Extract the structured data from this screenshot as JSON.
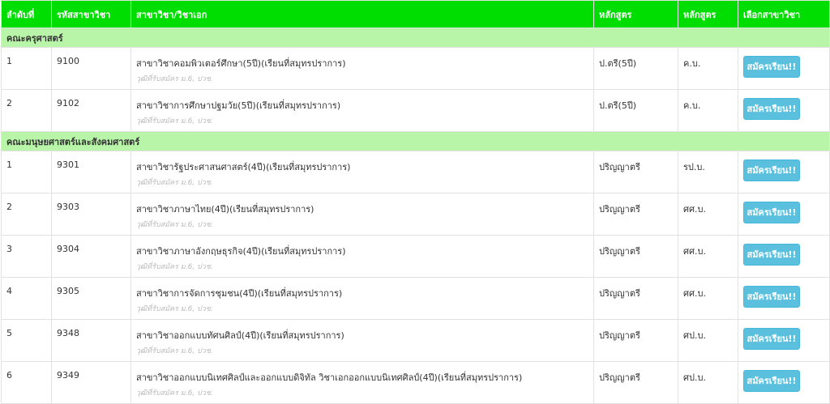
{
  "headers": [
    "ลำดับที่",
    "รหัสสาขาวิชา",
    "สาขาวิชา/วิชาเอก",
    "หลักสูตร",
    "หลักสูตร",
    "เลือกสาขาวิชา"
  ],
  "faculties": [
    {
      "name": "คณะครุศาสตร์",
      "rows": [
        {
          "no": "1",
          "code": "9100",
          "program": "สาขาวิชาคอมพิวเตอร์ศึกษา(5ปี)(เรียนที่สมุทรปราการ)",
          "note": "วุฒิที่รับสมัคร ม.6, ปวช.",
          "curriculum": "ป.ตรี(5ปี)",
          "degree": "ค.บ.",
          "button": "สมัครเรียน!!"
        },
        {
          "no": "2",
          "code": "9102",
          "program": "สาขาวิชาการศึกษาปฐมวัย(5ปี)(เรียนที่สมุทรปราการ)",
          "note": "วุฒิที่รับสมัคร ม.6, ปวช.",
          "curriculum": "ป.ตรี(5ปี)",
          "degree": "ค.บ.",
          "button": "สมัครเรียน!!"
        }
      ]
    },
    {
      "name": "คณะมนุษยศาสตร์และสังคมศาสตร์",
      "rows": [
        {
          "no": "1",
          "code": "9301",
          "program": "สาขาวิชารัฐประศาสนศาสตร์(4ปี)(เรียนที่สมุทรปราการ)",
          "note": "วุฒิที่รับสมัคร ม.6, ปวช.",
          "curriculum": "ปริญญาตรี",
          "degree": "รป.บ.",
          "button": "สมัครเรียน!!"
        },
        {
          "no": "2",
          "code": "9303",
          "program": "สาขาวิชาภาษาไทย(4ปี)(เรียนที่สมุทรปราการ)",
          "note": "วุฒิที่รับสมัคร ม.6, ปวช.",
          "curriculum": "ปริญญาตรี",
          "degree": "ศศ.บ.",
          "button": "สมัครเรียน!!"
        },
        {
          "no": "3",
          "code": "9304",
          "program": "สาขาวิชาภาษาอังกฤษธุรกิจ(4ปี)(เรียนที่สมุทรปราการ)",
          "note": "วุฒิที่รับสมัคร ม.6, ปวช.",
          "curriculum": "ปริญญาตรี",
          "degree": "ศศ.บ.",
          "button": "สมัครเรียน!!"
        },
        {
          "no": "4",
          "code": "9305",
          "program": "สาขาวิชาการจัดการชุมชน(4ปี)(เรียนที่สมุทรปราการ)",
          "note": "วุฒิที่รับสมัคร ม.6, ปวช.",
          "curriculum": "ปริญญาตรี",
          "degree": "ศศ.บ.",
          "button": "สมัครเรียน!!"
        },
        {
          "no": "5",
          "code": "9348",
          "program": "สาขาวิชาออกแบบทัศนศิลป์(4ปี)(เรียนที่สมุทรปราการ)",
          "note": "วุฒิที่รับสมัคร ม.6, ปวช.",
          "curriculum": "ปริญญาตรี",
          "degree": "ศป.บ.",
          "button": "สมัครเรียน!!"
        },
        {
          "no": "6",
          "code": "9349",
          "program": "สาขาวิชาออกแบบนิเทศศิลป์และออกแบบดิจิทัล วิชาเอกออกแบบนิเทศศิลป์(4ปี)(เรียนที่สมุทรปราการ)",
          "note": "วุฒิที่รับสมัคร ม.6, ปวช.",
          "curriculum": "ปริญญาตรี",
          "degree": "ศป.บ.",
          "button": "สมัครเรียน!!"
        }
      ]
    }
  ],
  "colors": {
    "header_bg": "#00dd00",
    "faculty_bg": "#b8f5a8",
    "button_bg": "#5bc0de"
  }
}
